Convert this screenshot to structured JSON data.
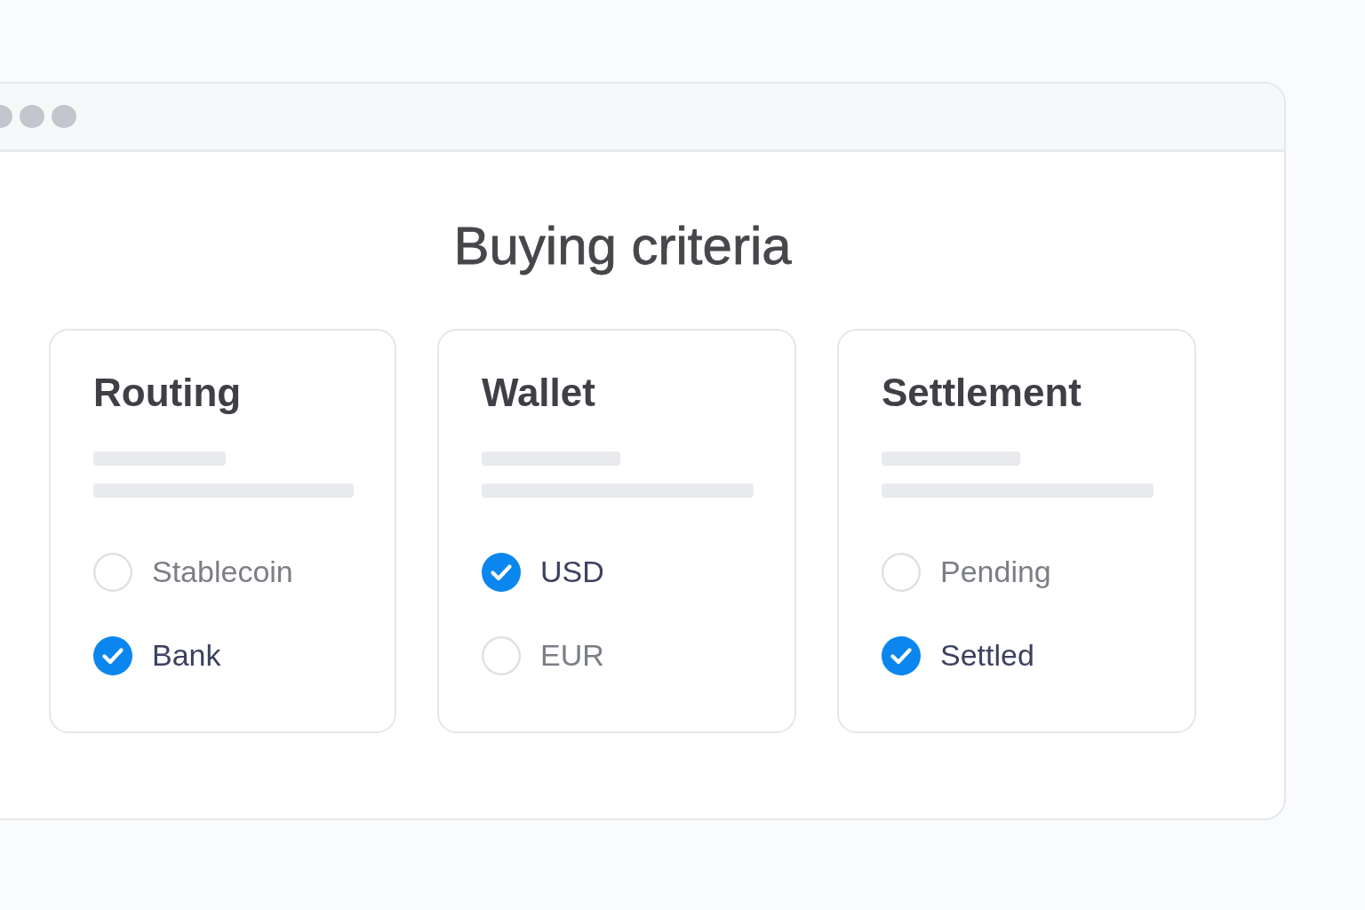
{
  "heading": "Buying criteria",
  "cards": [
    {
      "title": "Routing",
      "options": [
        {
          "label": "Stablecoin",
          "selected": false
        },
        {
          "label": "Bank",
          "selected": true
        }
      ]
    },
    {
      "title": "Wallet",
      "options": [
        {
          "label": "USD",
          "selected": true
        },
        {
          "label": "EUR",
          "selected": false
        }
      ]
    },
    {
      "title": "Settlement",
      "options": [
        {
          "label": "Pending",
          "selected": false
        },
        {
          "label": "Settled",
          "selected": true
        }
      ]
    }
  ]
}
